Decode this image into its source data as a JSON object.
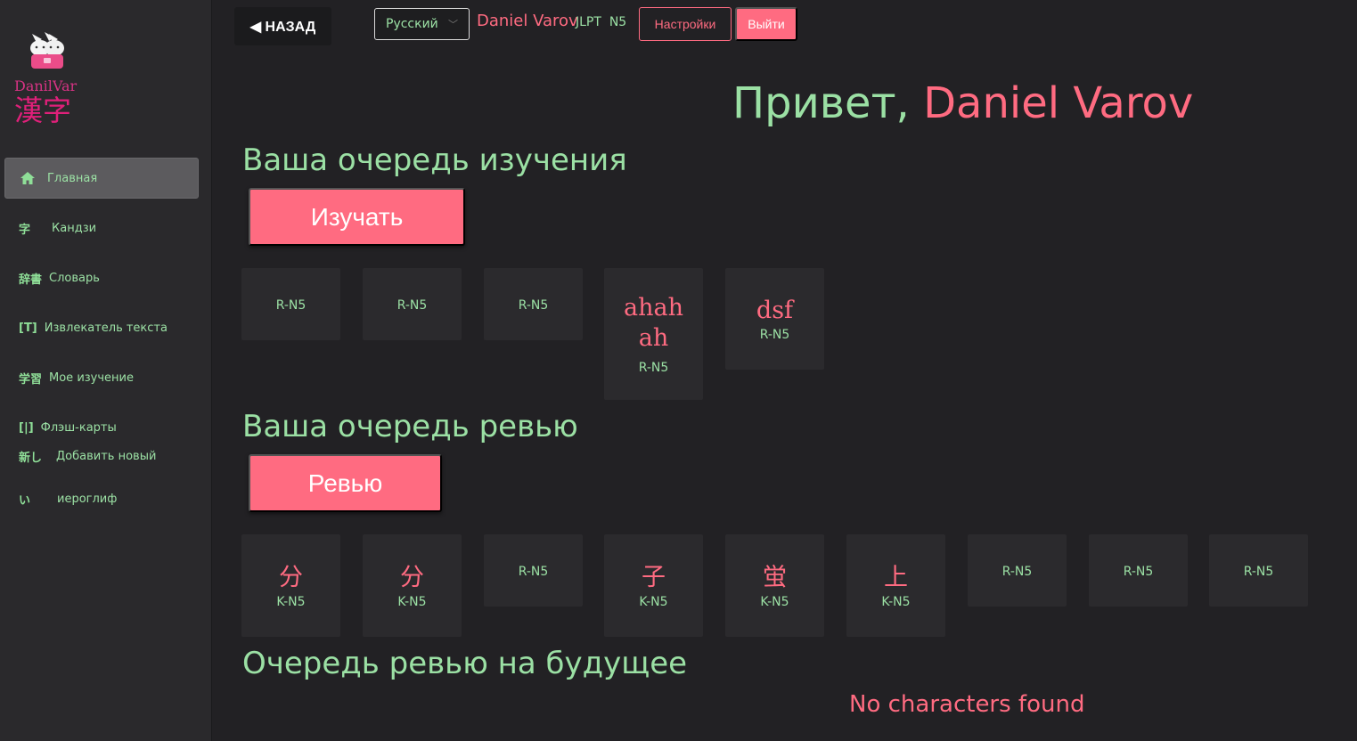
{
  "brand": {
    "name": "DanilVar",
    "kanji": "漢字"
  },
  "sidebar": {
    "items": [
      {
        "icon": "⌂",
        "label": "Главная",
        "active": true
      },
      {
        "icon": "字",
        "label": "Кандзи"
      },
      {
        "icon": "辞書",
        "label": "Словарь"
      },
      {
        "icon": "[T]",
        "label": "Извлекатель текста"
      },
      {
        "icon": "学習",
        "label": "Мое изучение"
      },
      {
        "icon": "[|]",
        "label": "Флэш-карты"
      },
      {
        "icon": "新し",
        "label": "Добавить новый"
      },
      {
        "icon": "い",
        "label": "иероглиф"
      }
    ]
  },
  "topbar": {
    "back_label": "◀ НАЗАД",
    "language": "Русский",
    "user_name": "Daniel Varov",
    "user_level": "JLPT  N5",
    "settings_label": "Настройки",
    "logout_label": "Выйти"
  },
  "greeting": {
    "prefix": "Привет, ",
    "name": "Daniel Varov"
  },
  "learn": {
    "title": "Ваша очередь изучения",
    "button": "Изучать",
    "cards": [
      {
        "char": "",
        "tag": "R-N5"
      },
      {
        "char": "",
        "tag": "R-N5"
      },
      {
        "char": "",
        "tag": "R-N5"
      },
      {
        "char": "ahah ah",
        "tag": "R-N5"
      },
      {
        "char": "dsf",
        "tag": "R-N5"
      }
    ]
  },
  "review": {
    "title": "Ваша очередь ревью",
    "button": "Ревью",
    "cards": [
      {
        "char": "分",
        "tag": "K-N5"
      },
      {
        "char": "分",
        "tag": "K-N5"
      },
      {
        "char": "",
        "tag": "R-N5"
      },
      {
        "char": "子",
        "tag": "K-N5"
      },
      {
        "char": "蛍",
        "tag": "K-N5"
      },
      {
        "char": "上",
        "tag": "K-N5"
      },
      {
        "char": "",
        "tag": "R-N5"
      },
      {
        "char": "",
        "tag": "R-N5"
      },
      {
        "char": "",
        "tag": "R-N5"
      }
    ]
  },
  "future": {
    "title": "Очередь ревью на будущее",
    "empty": "No characters found"
  }
}
